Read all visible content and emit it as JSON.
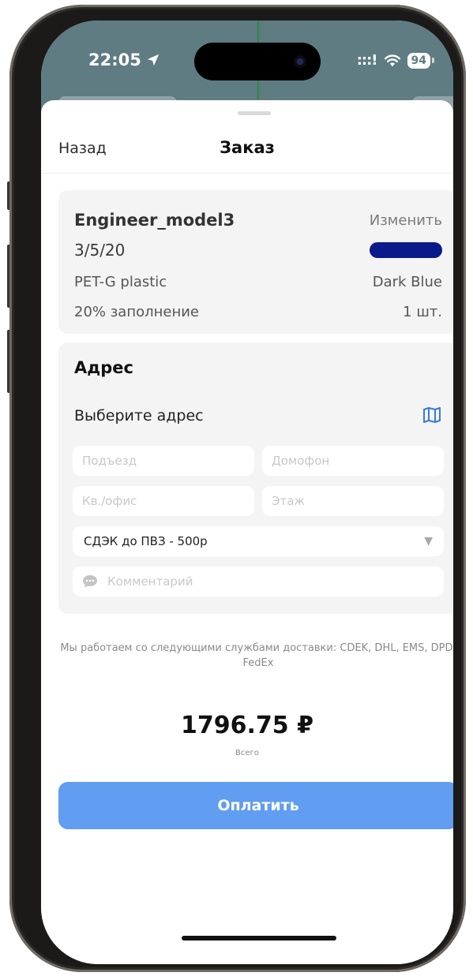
{
  "status_bar": {
    "time": "22:05",
    "signal": ":::!",
    "battery": "94"
  },
  "nav": {
    "back_label": "Назад",
    "title": "Заказ"
  },
  "model_card": {
    "name": "Engineer_model3",
    "change_label": "Изменить",
    "dimensions": "3/5/20",
    "material": "PET-G plastic",
    "color_name": "Dark Blue",
    "color_hex": "#0a1a8a",
    "infill": "20% заполнение",
    "quantity": "1 шт."
  },
  "address_card": {
    "title": "Адрес",
    "select_label": "Выберите адрес",
    "entrance_placeholder": "Подъезд",
    "intercom_placeholder": "Домофон",
    "apartment_placeholder": "Кв./офис",
    "floor_placeholder": "Этаж",
    "delivery_selected": "СДЭК до ПВЗ - 500р",
    "comment_placeholder": "Комментарий"
  },
  "delivery_info": "Мы работаем со следующими службами доставки: CDEK, DHL, EMS, DPD, FedEx",
  "total": {
    "amount": "1796.75 ₽",
    "label": "Всего"
  },
  "pay_button": {
    "label": "Оплатить",
    "color": "#619df0"
  }
}
